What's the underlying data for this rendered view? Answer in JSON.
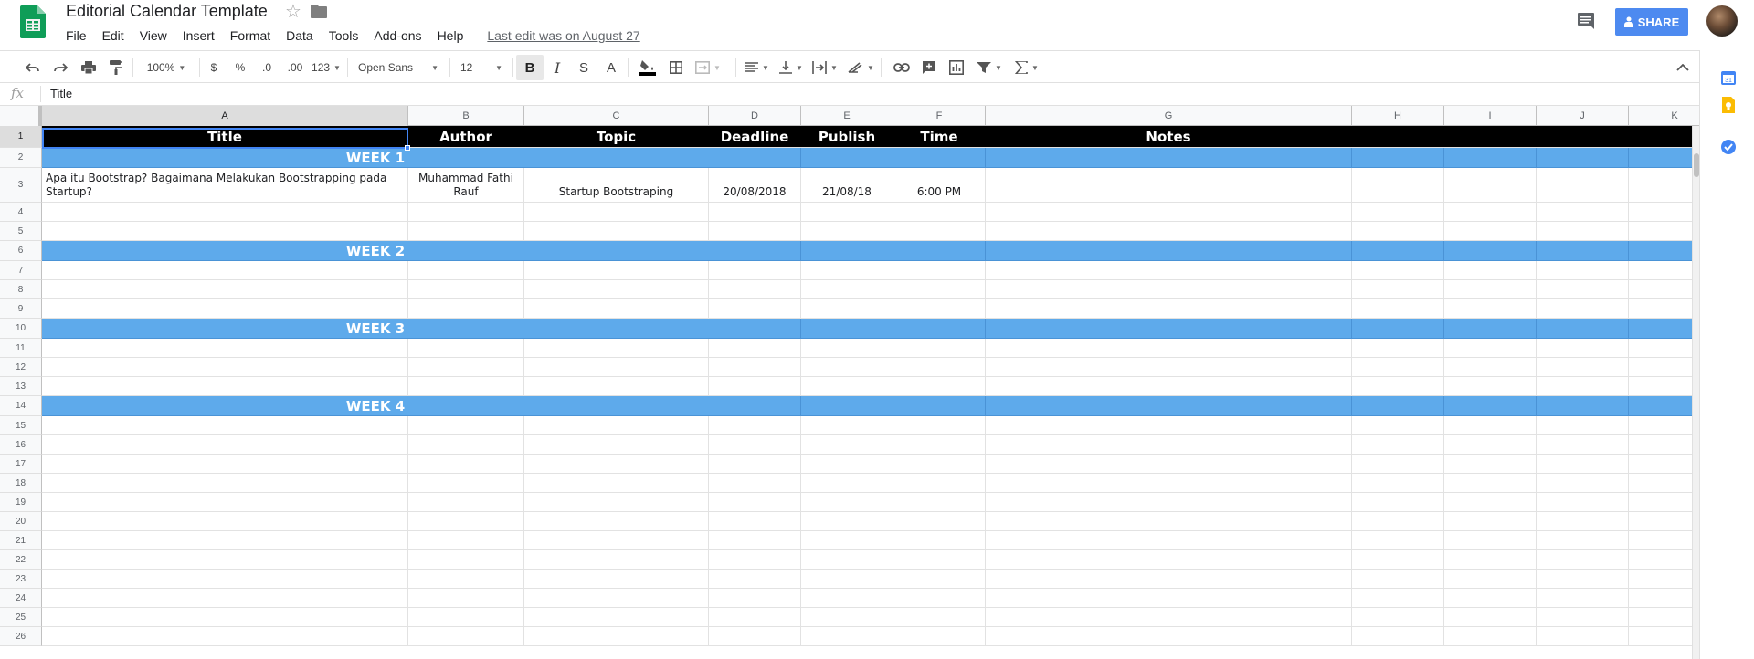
{
  "app": {
    "doc_title": "Editorial Calendar Template",
    "last_edit": "Last edit was on August 27",
    "share_label": "SHARE",
    "brand_color": "#0f9d58",
    "share_color": "#4d8af0"
  },
  "menu": {
    "items": [
      "File",
      "Edit",
      "View",
      "Insert",
      "Format",
      "Data",
      "Tools",
      "Add-ons",
      "Help"
    ]
  },
  "toolbar": {
    "zoom": "100%",
    "currency": "$",
    "percent": "%",
    "decrease_decimals": ".0",
    "increase_decimals": ".00",
    "more_formats": "123",
    "font": "Open Sans",
    "font_size": "12",
    "bold": "B",
    "italic": "I",
    "strikethrough": "S",
    "text_color": "A",
    "icons": [
      "undo-icon",
      "redo-icon",
      "print-icon",
      "paint-format-icon",
      "fill-color-icon",
      "borders-icon",
      "merge-cells-icon",
      "align-icon",
      "valign-icon",
      "wrap-icon",
      "rotate-icon",
      "link-icon",
      "comment-icon",
      "chart-icon",
      "filter-icon",
      "functions-icon",
      "collapse-icon"
    ]
  },
  "formula_bar": {
    "fx": "fx",
    "value": "Title"
  },
  "grid": {
    "columns": [
      "A",
      "B",
      "C",
      "D",
      "E",
      "F",
      "G",
      "H",
      "I",
      "J",
      "K"
    ],
    "selected_column": "A",
    "row_numbers": [
      "1",
      "2",
      "3",
      "4",
      "5",
      "6",
      "7",
      "8",
      "9",
      "10",
      "11",
      "12",
      "13",
      "14",
      "15",
      "16",
      "17",
      "18",
      "19",
      "20",
      "21",
      "22",
      "23",
      "24",
      "25",
      "26"
    ],
    "selected_row": "1",
    "header_row": [
      "Title",
      "Author",
      "Topic",
      "Deadline",
      "Publish",
      "Time",
      "Notes"
    ],
    "weeks": [
      "WEEK 1",
      "WEEK 2",
      "WEEK 3",
      "WEEK 4"
    ],
    "data_row": {
      "title": "Apa itu Bootstrap? Bagaimana Melakukan Bootstrapping pada Startup?",
      "author": "Muhammad Fathi Rauf",
      "topic": "Startup Bootstraping",
      "deadline": "20/08/2018",
      "publish": "21/08/18",
      "time": "6:00 PM"
    },
    "header_bg": "#000000",
    "week_bg": "#5eaaeb"
  },
  "side_panel": {
    "icons": [
      "calendar-icon",
      "keep-icon",
      "tasks-icon"
    ]
  }
}
